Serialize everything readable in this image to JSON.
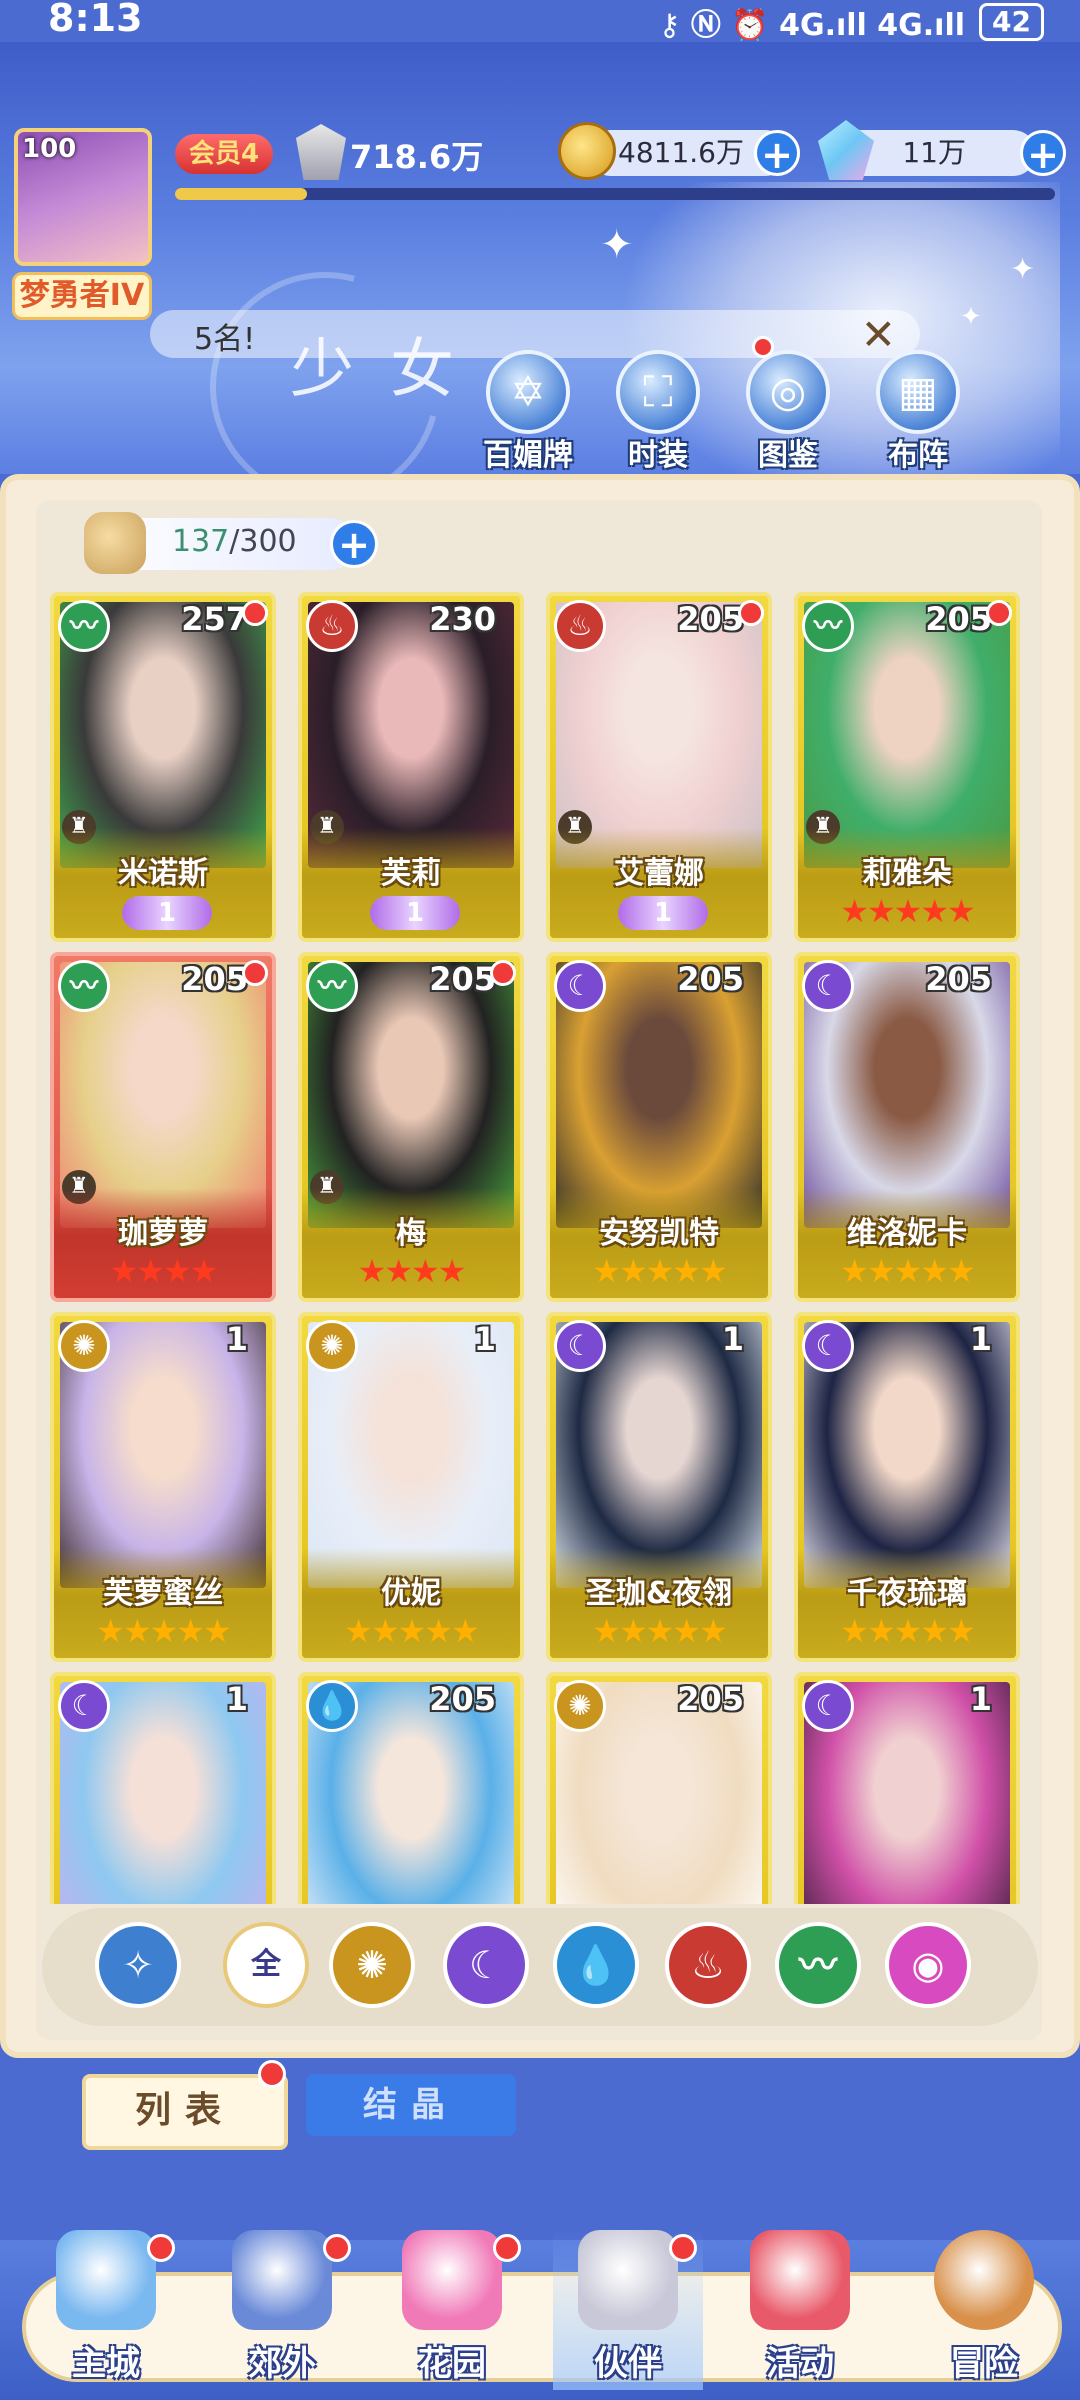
{
  "status": {
    "time": "8:13",
    "icons": "⚷ Ⓝ ⏰ 4G.ıll 4G.ıll",
    "battery": "42"
  },
  "header": {
    "avatar_level": "100",
    "rank_title": "梦勇者IV",
    "vip": "会员4",
    "power": "718.6万",
    "exp_fraction": 0.15,
    "gold": "4811.6万",
    "gems": "11万",
    "marquee": "5名!",
    "banner_title": "少女"
  },
  "features": [
    {
      "label": "百媚牌",
      "icon": "hexagram-icon"
    },
    {
      "label": "时装",
      "icon": "outfit-icon"
    },
    {
      "label": "图鉴",
      "icon": "codex-icon"
    },
    {
      "label": "布阵",
      "icon": "formation-grid-icon"
    }
  ],
  "inventory": {
    "count": "137",
    "max": "300"
  },
  "elements": {
    "wind": {
      "color": "#2f9e55",
      "glyph": "〰"
    },
    "fire": {
      "color": "#c83a32",
      "glyph": "♨"
    },
    "dark": {
      "color": "#7a4ad0",
      "glyph": "☾"
    },
    "light": {
      "color": "#c9951e",
      "glyph": "✺"
    },
    "water": {
      "color": "#2b8fd6",
      "glyph": "💧"
    }
  },
  "partners": [
    {
      "name": "米诺斯",
      "level": "257",
      "element": "wind",
      "stars": 0,
      "wing": "1",
      "role": true,
      "dot": true,
      "art": [
        "#3a3a3a",
        "#e9d0c5",
        "#3fae4e"
      ]
    },
    {
      "name": "芙莉",
      "level": "230",
      "element": "fire",
      "stars": 0,
      "wing": "1",
      "role": true,
      "dot": false,
      "art": [
        "#2a1e28",
        "#e9b8b8",
        "#5a2a3a"
      ]
    },
    {
      "name": "艾蕾娜",
      "level": "205",
      "element": "fire",
      "stars": 0,
      "wing": "1",
      "role": true,
      "dot": true,
      "art": [
        "#f0d0d0",
        "#f5e5e0",
        "#c9c0c6"
      ]
    },
    {
      "name": "莉雅朵",
      "level": "205",
      "element": "wind",
      "stars": 5,
      "star_color": "red",
      "role": true,
      "dot": true,
      "art": [
        "#3fae6a",
        "#eed2c2",
        "#4b9a44"
      ]
    },
    {
      "name": "珈萝萝",
      "level": "205",
      "element": "wind",
      "stars": 4,
      "star_color": "red",
      "role": true,
      "dot": true,
      "red": true,
      "art": [
        "#e6d08a",
        "#f5d8c8",
        "#f08070"
      ]
    },
    {
      "name": "梅",
      "level": "205",
      "element": "wind",
      "stars": 4,
      "star_color": "red",
      "role": true,
      "dot": true,
      "art": [
        "#222",
        "#eac8b6",
        "#49a53e"
      ]
    },
    {
      "name": "安努凯特",
      "level": "205",
      "element": "dark",
      "stars": 5,
      "star_color": "gold",
      "role": false,
      "dot": false,
      "art": [
        "#d9a032",
        "#6b4a3c",
        "#2a2a2a"
      ]
    },
    {
      "name": "维洛妮卡",
      "level": "205",
      "element": "dark",
      "stars": 5,
      "star_color": "gold",
      "role": false,
      "dot": false,
      "art": [
        "#d8d8e8",
        "#8a5a44",
        "#6a4a9a"
      ]
    },
    {
      "name": "芙萝蜜丝",
      "level": "1",
      "element": "light",
      "stars": 5,
      "star_color": "gold",
      "role": false,
      "dot": false,
      "art": [
        "#c8b4e8",
        "#f5dccc",
        "#3a2a2a"
      ]
    },
    {
      "name": "优妮",
      "level": "1",
      "element": "light",
      "stars": 5,
      "star_color": "gold",
      "role": false,
      "dot": false,
      "art": [
        "#e8eef8",
        "#f5e2d8",
        "#dce6f5"
      ]
    },
    {
      "name": "圣珈&夜翎",
      "level": "1",
      "element": "dark",
      "stars": 5,
      "star_color": "gold",
      "role": false,
      "dot": false,
      "art": [
        "#1e2a44",
        "#e6d6d2",
        "#dfe6ee"
      ]
    },
    {
      "name": "千夜琉璃",
      "level": "1",
      "element": "dark",
      "stars": 5,
      "star_color": "gold",
      "role": false,
      "dot": false,
      "art": [
        "#1e2444",
        "#f2d8c8",
        "#e8e4f0"
      ]
    },
    {
      "name": "",
      "level": "1",
      "element": "dark",
      "stars": 0,
      "role": false,
      "dot": false,
      "art": [
        "#8ec8f0",
        "#f5e0d8",
        "#c6b0f0"
      ]
    },
    {
      "name": "",
      "level": "205",
      "element": "water",
      "stars": 0,
      "role": false,
      "dot": false,
      "art": [
        "#5ab0e8",
        "#f5e6dc",
        "#e8f0fa"
      ]
    },
    {
      "name": "",
      "level": "205",
      "element": "light",
      "stars": 0,
      "role": false,
      "dot": false,
      "art": [
        "#f0dcc0",
        "#f5e6d8",
        "#ffffff"
      ]
    },
    {
      "name": "",
      "level": "1",
      "element": "dark",
      "stars": 0,
      "role": false,
      "dot": false,
      "art": [
        "#d050a8",
        "#f0d0d0",
        "#3a1e3a"
      ]
    }
  ],
  "filters": [
    {
      "name": "filter-wing",
      "glyph": "✧",
      "color": "#3f7fd0"
    },
    {
      "name": "filter-all",
      "glyph": "全",
      "color": "#ffffff"
    },
    {
      "name": "filter-light",
      "glyph": "✺",
      "color": "#c9951e"
    },
    {
      "name": "filter-dark",
      "glyph": "☾",
      "color": "#7a4ad0"
    },
    {
      "name": "filter-water",
      "glyph": "💧",
      "color": "#2b8fd6"
    },
    {
      "name": "filter-fire",
      "glyph": "♨",
      "color": "#c83a32"
    },
    {
      "name": "filter-wind",
      "glyph": "〰",
      "color": "#2f9e55"
    },
    {
      "name": "filter-pink",
      "glyph": "◉",
      "color": "#d84ac0"
    }
  ],
  "tabs": {
    "list": "列表",
    "crystal": "结晶"
  },
  "nav": [
    {
      "label": "主城",
      "icon": "castle-icon",
      "color": "#7ab8f0",
      "dot": true
    },
    {
      "label": "郊外",
      "icon": "portal-icon",
      "color": "#6a8ad8",
      "dot": true
    },
    {
      "label": "花园",
      "icon": "heart-icon",
      "color": "#f07ab8",
      "dot": true
    },
    {
      "label": "伙伴",
      "icon": "partner-icon",
      "color": "#c8c8d8",
      "dot": true,
      "active": true
    },
    {
      "label": "活动",
      "icon": "gift-icon",
      "color": "#e85a6a",
      "dot": false
    },
    {
      "label": "冒险",
      "icon": "compass-icon",
      "color": "#d8904a",
      "dot": false
    }
  ]
}
